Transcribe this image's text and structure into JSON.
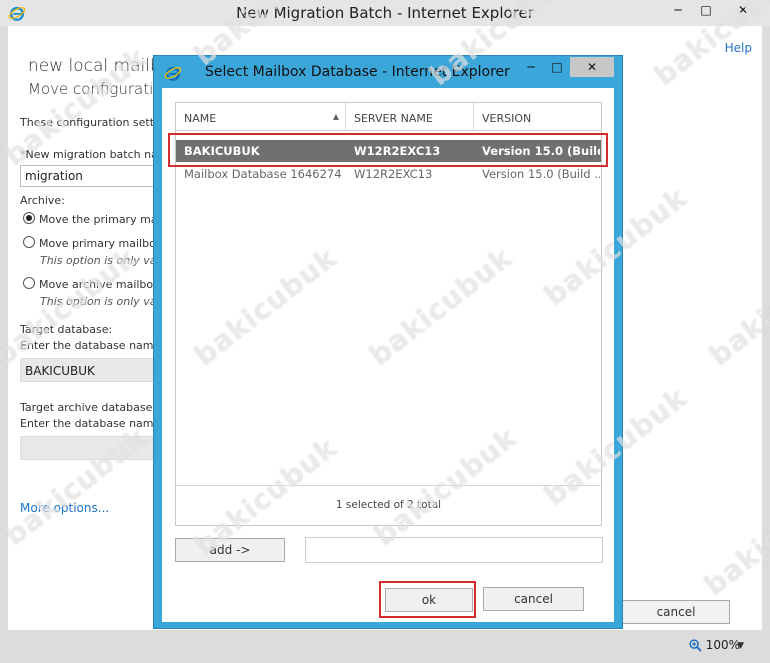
{
  "outer_window": {
    "title": "New Migration Batch - Internet Explorer",
    "help_label": "Help",
    "heading": "new local mailbo",
    "subheading": "Move configuration",
    "description": "These configuration setti",
    "batch_name_label": "*New migration batch na",
    "batch_name_value": "migration",
    "archive_label": "Archive:",
    "archive_options": [
      {
        "label": "Move the primary ma",
        "note": "",
        "checked": true
      },
      {
        "label": "Move primary mailbo",
        "note": "This option is only va",
        "checked": false
      },
      {
        "label": "Move archive mailbo",
        "note": "This option is only va",
        "checked": false
      }
    ],
    "target_db_label": "Target database:",
    "target_db_hint": "Enter the database name",
    "target_db_value": "BAKICUBUK",
    "target_archive_label": "Target archive database:",
    "target_archive_hint": "Enter the database name",
    "target_archive_value": "",
    "more_options": "More options...",
    "cancel_label": "cancel",
    "zoom_label": "100%"
  },
  "dialog": {
    "title": "Select Mailbox Database - Internet Explorer",
    "columns": [
      "NAME",
      "SERVER NAME",
      "VERSION"
    ],
    "rows": [
      {
        "name": "BAKICUBUK",
        "server": "W12R2EXC13",
        "version": "Version 15.0 (Build...",
        "selected": true
      },
      {
        "name": "Mailbox Database 1646274...",
        "server": "W12R2EXC13",
        "version": "Version 15.0 (Build ...",
        "selected": false
      }
    ],
    "selection_status": "1 selected of 2 total",
    "add_label": "add ->",
    "add_value": "",
    "ok_label": "ok",
    "cancel_label": "cancel"
  },
  "watermark_text": "bakicubuk",
  "colors": {
    "dialog_frame": "#3aa6da",
    "selected_row": "#707070",
    "highlight_box": "#d42b2b",
    "link": "#1e74c6"
  },
  "icons": {
    "app": "internet-explorer-icon",
    "minimize": "minimize-icon",
    "maximize": "maximize-icon",
    "close": "close-icon",
    "sort": "sort-ascending-icon",
    "zoom": "zoom-icon",
    "dropdown": "chevron-down-icon"
  }
}
